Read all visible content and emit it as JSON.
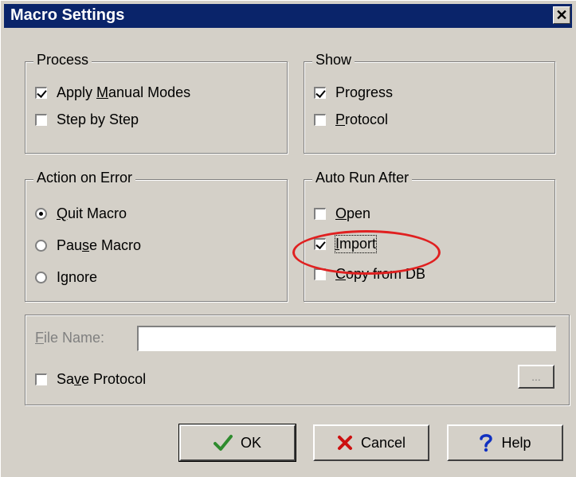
{
  "window": {
    "title": "Macro Settings",
    "close_glyph": "✕"
  },
  "process": {
    "legend": "Process",
    "apply_manual_modes": {
      "label_pre": "Apply ",
      "label_u": "M",
      "label_post": "anual Modes",
      "checked": true
    },
    "step_by_step": {
      "label": "Step by Step",
      "checked": false
    }
  },
  "show": {
    "legend": "Show",
    "progress": {
      "label": "Progress",
      "checked": true
    },
    "protocol": {
      "label_u": "P",
      "label_post": "rotocol",
      "checked": false
    }
  },
  "action_on_error": {
    "legend": "Action on Error",
    "quit_macro": {
      "label_u": "Q",
      "label_post": "uit Macro",
      "selected": true
    },
    "pause_macro": {
      "label_pre": "Pau",
      "label_u": "s",
      "label_post": "e Macro",
      "selected": false
    },
    "ignore": {
      "label_pre": "I",
      "label_u": "g",
      "label_post": "nore",
      "selected": false
    }
  },
  "auto_run_after": {
    "legend": "Auto Run After",
    "open": {
      "label_u": "O",
      "label_post": "pen",
      "checked": false
    },
    "import": {
      "label_u": "I",
      "label_post": "mport",
      "checked": true
    },
    "copy_from_db": {
      "label_u": "C",
      "label_post": "opy from DB",
      "checked": false
    }
  },
  "file": {
    "file_name_label_u": "F",
    "file_name_label_post": "ile Name:",
    "file_name_value": "",
    "save_protocol": {
      "label_pre": "Sa",
      "label_u": "v",
      "label_post": "e Protocol",
      "checked": false
    },
    "browse_label": "..."
  },
  "buttons": {
    "ok": "OK",
    "cancel": "Cancel",
    "help": "Help"
  },
  "icons": {
    "ok": "check-icon",
    "cancel": "x-icon",
    "help": "question-icon"
  },
  "colors": {
    "title_bar": "#0a246a",
    "face": "#d4d0c8",
    "ok_icon": "#2e8b2e",
    "cancel_icon": "#cc1010",
    "help_icon": "#1030c0",
    "highlight": "#e02020"
  }
}
